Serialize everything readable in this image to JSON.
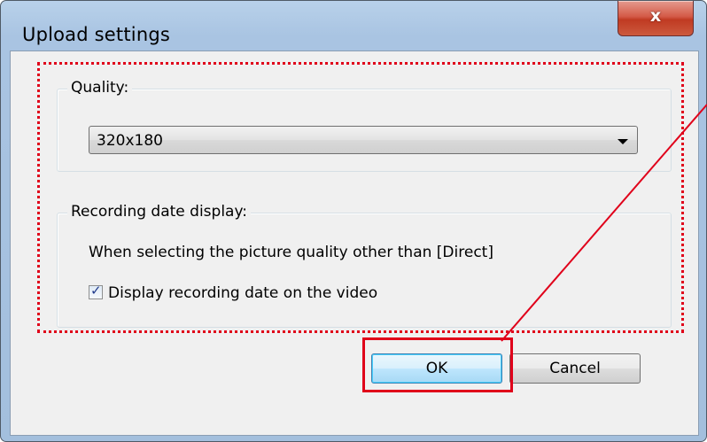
{
  "window": {
    "title": "Upload settings",
    "close_glyph": "x"
  },
  "quality": {
    "group_label": "Quality:",
    "selected": "320x180"
  },
  "recording_date": {
    "group_label": "Recording date display:",
    "note": "When selecting the picture quality other than [Direct]",
    "checkbox_label": "Display recording date on the video",
    "checked": true
  },
  "buttons": {
    "ok_label": "OK",
    "cancel_label": "Cancel"
  },
  "annotations": {
    "frame_color": "#e0001a"
  }
}
